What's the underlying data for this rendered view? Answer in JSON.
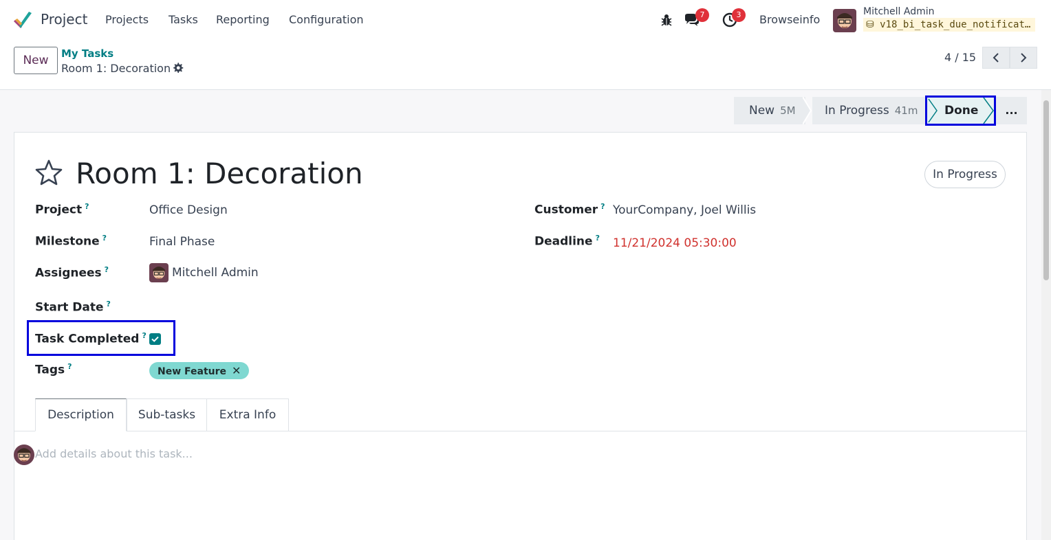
{
  "app": {
    "name": "Project"
  },
  "menu": [
    "Projects",
    "Tasks",
    "Reporting",
    "Configuration"
  ],
  "systray": {
    "messages_count": "7",
    "activities_count": "3",
    "company": "Browseinfo",
    "user_name": "Mitchell Admin",
    "database": "v18_bi_task_due_notification"
  },
  "control_panel": {
    "new_label": "New",
    "breadcrumb_parent": "My Tasks",
    "breadcrumb_current": "Room 1: Decoration",
    "pager": "4 / 15"
  },
  "stages": [
    {
      "name": "New",
      "duration": "5M"
    },
    {
      "name": "In Progress",
      "duration": "41m"
    },
    {
      "name": "Done",
      "duration": ""
    }
  ],
  "stages_more": "...",
  "form": {
    "title": "Room 1: Decoration",
    "state": "In Progress",
    "fields": {
      "project": {
        "label": "Project",
        "help": "?",
        "value": "Office Design"
      },
      "milestone": {
        "label": "Milestone",
        "help": "?",
        "value": "Final Phase"
      },
      "assignees": {
        "label": "Assignees",
        "help": "?",
        "value": "Mitchell Admin"
      },
      "start_date": {
        "label": "Start Date",
        "help": "?",
        "value": ""
      },
      "task_completed": {
        "label": "Task Completed",
        "help": "?",
        "checked": true
      },
      "tags": {
        "label": "Tags",
        "help": "?",
        "values": [
          "New Feature"
        ]
      },
      "customer": {
        "label": "Customer",
        "help": "?",
        "value": "YourCompany, Joel Willis"
      },
      "deadline": {
        "label": "Deadline",
        "help": "?",
        "value": "11/21/2024 05:30:00"
      }
    },
    "tabs": [
      "Description",
      "Sub-tasks",
      "Extra Info"
    ],
    "description_placeholder": "Add details about this task..."
  },
  "colors": {
    "accent": "#017e84",
    "brand": "#5b2c56",
    "deadline": "#d0312d",
    "highlight": "#0000dd",
    "tag_bg": "#7fd8d1"
  }
}
